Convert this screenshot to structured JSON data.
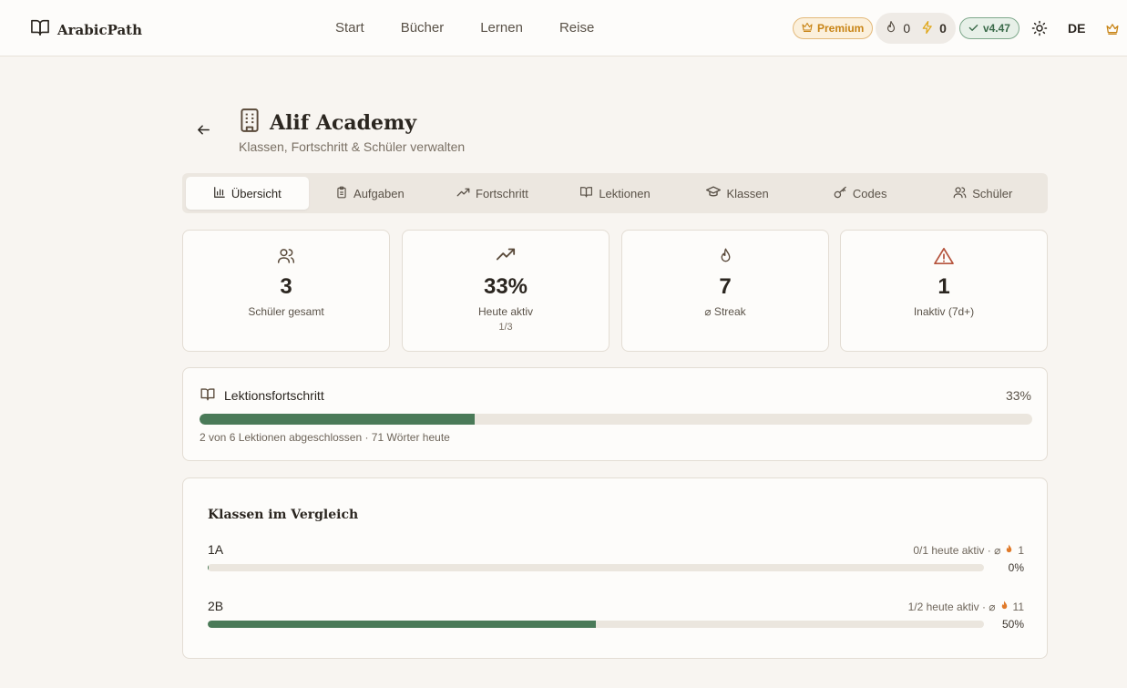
{
  "app": {
    "name": "ArabicPath"
  },
  "nav": [
    {
      "label": "Start"
    },
    {
      "label": "Bücher"
    },
    {
      "label": "Lernen"
    },
    {
      "label": "Reise"
    }
  ],
  "topbar": {
    "premium_label": "Premium",
    "streak_count": "0",
    "xp_count": "0",
    "version": "v4.47",
    "language": "DE"
  },
  "header": {
    "title": "Alif Academy",
    "subtitle": "Klassen, Fortschritt & Schüler verwalten"
  },
  "tabs": [
    {
      "label": "Übersicht",
      "icon": "bar-chart-icon",
      "active": true
    },
    {
      "label": "Aufgaben",
      "icon": "clipboard-icon"
    },
    {
      "label": "Fortschritt",
      "icon": "trending-up-icon"
    },
    {
      "label": "Lektionen",
      "icon": "book-open-icon"
    },
    {
      "label": "Klassen",
      "icon": "graduation-cap-icon"
    },
    {
      "label": "Codes",
      "icon": "key-icon"
    },
    {
      "label": "Schüler",
      "icon": "users-icon"
    }
  ],
  "stats": [
    {
      "value": "3",
      "label": "Schüler gesamt",
      "icon": "users-icon"
    },
    {
      "value": "33%",
      "label": "Heute aktiv",
      "sub": "1/3",
      "icon": "trending-up-icon"
    },
    {
      "value": "7",
      "label": "⌀ Streak",
      "icon": "flame-icon"
    },
    {
      "value": "1",
      "label": "Inaktiv (7d+)",
      "icon": "alert-triangle-icon"
    }
  ],
  "lesson_progress": {
    "title": "Lektionsfortschritt",
    "percent_label": "33%",
    "progress": 0.33,
    "note": "2 von 6 Lektionen abgeschlossen · 71 Wörter heute"
  },
  "class_comparison": {
    "title": "Klassen im Vergleich",
    "rows": [
      {
        "name": "1A",
        "meta_prefix": "0/1 heute aktiv · ⌀",
        "streak": "1",
        "percent_label": "0%",
        "progress": 0.0
      },
      {
        "name": "2B",
        "meta_prefix": "1/2 heute aktiv · ⌀",
        "streak": "11",
        "percent_label": "50%",
        "progress": 0.5
      }
    ]
  },
  "colors": {
    "accent_green": "#4a7a58",
    "premium_gold": "#c88415",
    "background": "#f8f5f1",
    "alert_red": "#b5533c",
    "flame_orange": "#e07a2a"
  }
}
